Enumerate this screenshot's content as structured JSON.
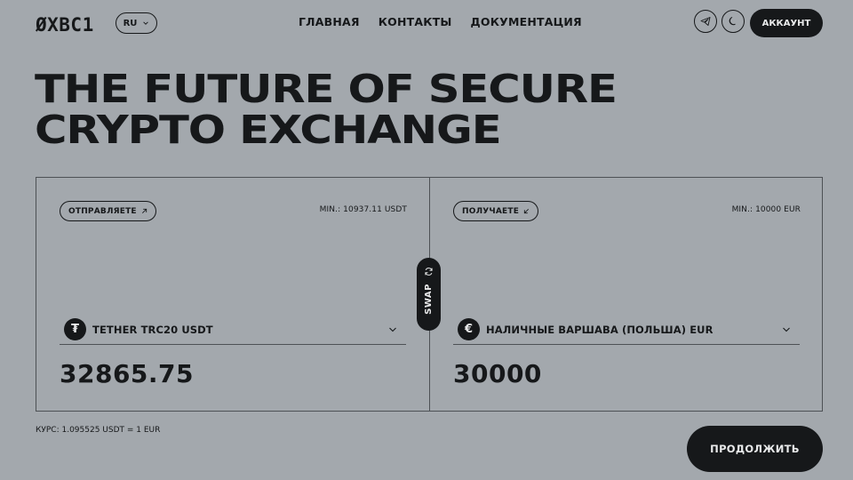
{
  "header": {
    "logo": "ØXBC1",
    "language": "RU",
    "nav": [
      "ГЛАВНАЯ",
      "КОНТАКТЫ",
      "ДОКУМЕНТАЦИЯ"
    ],
    "account_label": "АККАУНТ",
    "icons": [
      "telegram-icon",
      "moon-icon"
    ]
  },
  "hero": {
    "line1": "THE FUTURE OF SECURE",
    "line2": "CRYPTO EXCHANGE"
  },
  "exchange": {
    "send": {
      "label": "ОТПРАВЛЯЕТЕ",
      "min": "MIN.: 10937.11 USDT",
      "currency": "TETHER TRC20 USDT",
      "coin_symbol": "₮",
      "amount": "32865.75"
    },
    "swap_label": "SWAP",
    "receive": {
      "label": "ПОЛУЧАЕТЕ",
      "min": "MIN.: 10000 EUR",
      "currency": "НАЛИЧНЫЕ ВАРШАВА (ПОЛЬША) EUR",
      "coin_symbol": "€",
      "amount": "30000"
    }
  },
  "footer": {
    "rate": "КУРС: 1.095525 USDT = 1 EUR",
    "continue_label": "ПРОДОЛЖИТЬ"
  },
  "colors": {
    "background": "#a3a8ad",
    "dark": "#16181a",
    "light_text": "#e9eaeb"
  }
}
